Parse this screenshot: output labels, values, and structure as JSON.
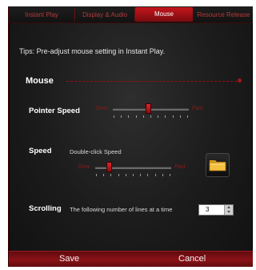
{
  "tabs": [
    {
      "label": "Instant Play",
      "active": false
    },
    {
      "label": "Display & Audio",
      "active": false
    },
    {
      "label": "Mouse",
      "active": true
    },
    {
      "label": "Resource Release",
      "active": false
    }
  ],
  "tips": "Tips: Pre-adjust mouse setting in Instant Play.",
  "section": {
    "title": "Mouse"
  },
  "pointer_speed": {
    "label": "Pointer Speed",
    "slow_label": "Slow",
    "fast_label": "Fast",
    "level": 0.46
  },
  "double_click": {
    "label": "Speed",
    "sublabel": "Double-click Speed",
    "slow_label": "Slow",
    "fast_label": "Fast",
    "level": 0.18,
    "test_icon": "folder-icon"
  },
  "scrolling": {
    "label": "Scrolling",
    "description": "The following number of lines at a time",
    "value": "3"
  },
  "footer": {
    "save": "Save",
    "cancel": "Cancel"
  },
  "colors": {
    "accent": "#c4161c",
    "background": "#1b1b1b",
    "footer": "#8b1217"
  }
}
